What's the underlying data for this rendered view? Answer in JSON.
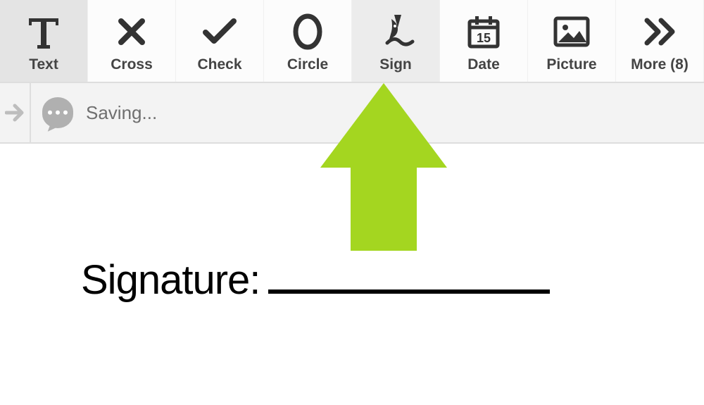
{
  "toolbar": {
    "tools": [
      {
        "label": "Text",
        "icon": "text-icon",
        "selected": true
      },
      {
        "label": "Cross",
        "icon": "cross-icon",
        "selected": false
      },
      {
        "label": "Check",
        "icon": "check-icon",
        "selected": false
      },
      {
        "label": "Circle",
        "icon": "circle-icon",
        "selected": false
      },
      {
        "label": "Sign",
        "icon": "sign-icon",
        "selected": false,
        "hover": true
      },
      {
        "label": "Date",
        "icon": "date-icon",
        "selected": false
      },
      {
        "label": "Picture",
        "icon": "picture-icon",
        "selected": false
      },
      {
        "label": "More (8)",
        "icon": "more-icon",
        "selected": false
      }
    ],
    "date_day": "15"
  },
  "status": {
    "text": "Saving..."
  },
  "document": {
    "signature_label": "Signature:"
  },
  "annotation": {
    "arrow_color": "#a4d620"
  }
}
